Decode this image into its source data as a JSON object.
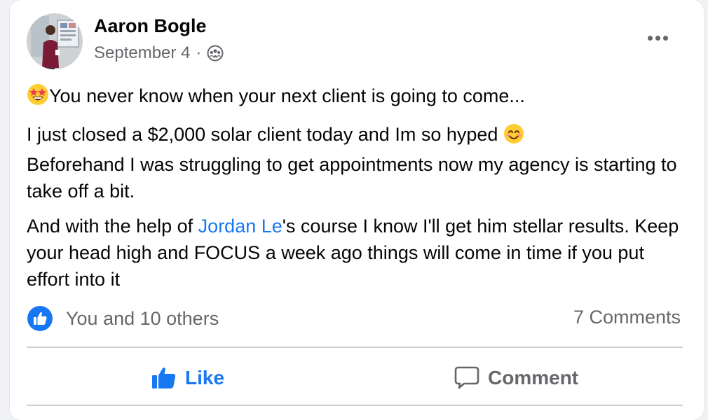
{
  "post": {
    "author": "Aaron Bogle",
    "date": "September 4",
    "separator": "·",
    "audience_icon": "group-icon",
    "menu_icon": "more-options-icon"
  },
  "content": {
    "line1": "You never know when your next client is going to come...",
    "para2_a": "I just closed a $2,000 solar client today and Im so hyped ",
    "para2_b": "Beforehand I was struggling to get appointments now my agency is starting to take off a bit.",
    "para3_pre": "And with the help of ",
    "para3_link": "Jordan Le",
    "para3_post": "'s course I know I'll get him stellar results. Keep your head high and FOCUS a week ago things will come in time if you put effort into it"
  },
  "stats": {
    "reactions": "You and 10 others",
    "comments": "7 Comments"
  },
  "actions": {
    "like": "Like",
    "comment": "Comment"
  },
  "colors": {
    "accent": "#1877f2",
    "secondary_text": "#65676b",
    "divider": "#ced0d4"
  }
}
